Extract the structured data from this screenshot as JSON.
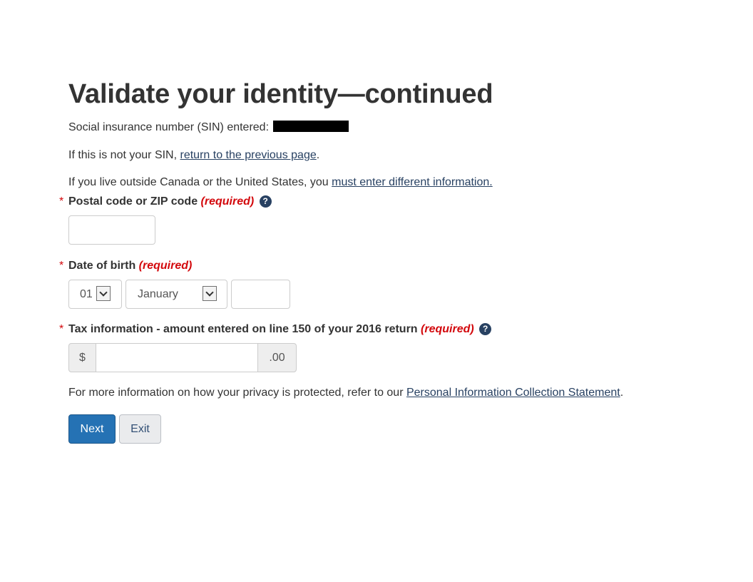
{
  "page": {
    "title": "Validate your identity—continued"
  },
  "sin": {
    "label": "Social insurance number (SIN) entered:"
  },
  "not_sin": {
    "prefix": "If this is not your SIN, ",
    "link": "return to the previous page",
    "suffix": "."
  },
  "outside": {
    "prefix": "If you live outside Canada or the United States, you ",
    "link": "must enter different information."
  },
  "postal": {
    "star": "*",
    "label": "Postal code or ZIP code",
    "required": "(required)",
    "help_glyph": "?",
    "value": ""
  },
  "dob": {
    "star": "*",
    "label": "Date of birth",
    "required": "(required)",
    "day_value": "01",
    "month_value": "January",
    "year_value": ""
  },
  "tax": {
    "star": "*",
    "label": "Tax information - amount entered on line 150 of your 2016 return",
    "required": "(required)",
    "help_glyph": "?",
    "prefix": "$",
    "suffix": ".00",
    "value": ""
  },
  "privacy": {
    "prefix": "For more information on how your privacy is protected, refer to our ",
    "link": "Personal Information Collection Statement",
    "suffix": "."
  },
  "buttons": {
    "next": "Next",
    "exit": "Exit"
  },
  "colors": {
    "link": "#284162",
    "required": "#d3080c",
    "primary_button": "#2572b4",
    "default_button": "#eaebed"
  },
  "icons": {
    "help": "question-circle-icon",
    "dropdown": "chevron-down-icon"
  }
}
